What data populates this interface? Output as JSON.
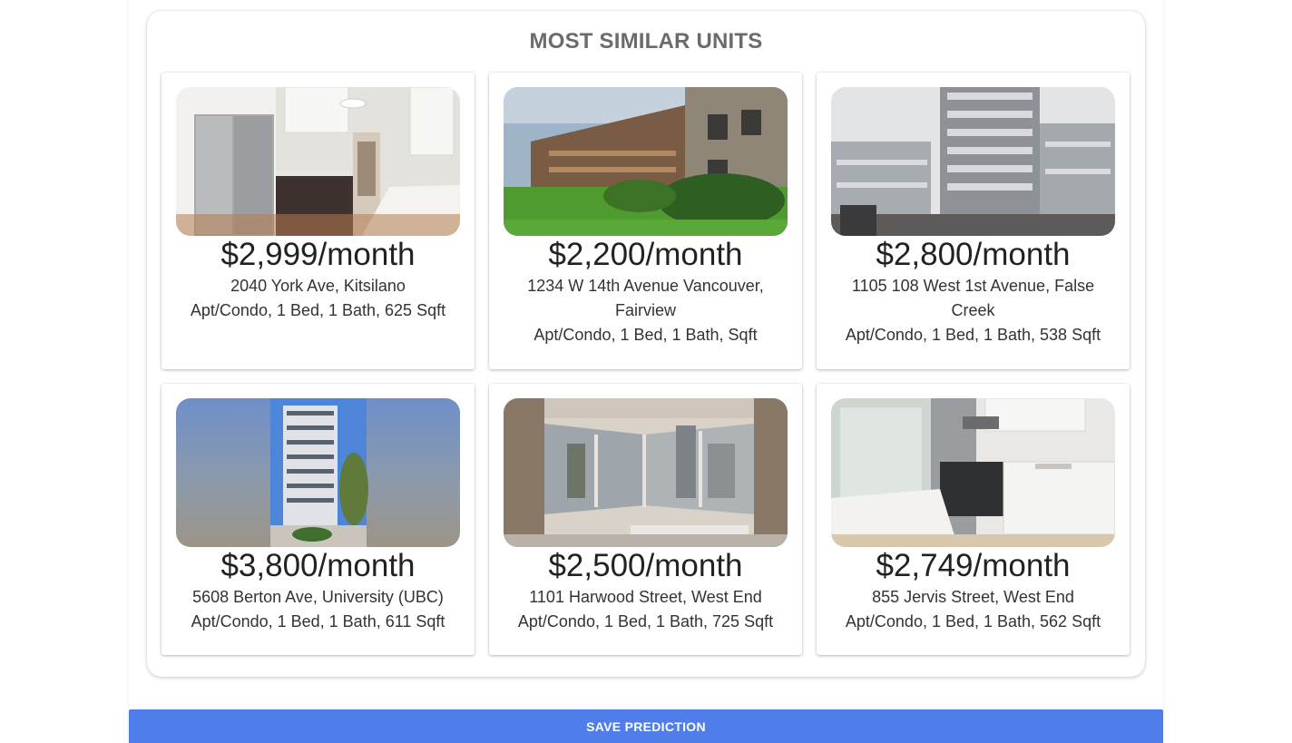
{
  "section": {
    "title": "MOST SIMILAR UNITS"
  },
  "listings": [
    {
      "price": "$2,999/month",
      "address": "2040 York Ave, Kitsilano",
      "specs": "Apt/Condo, 1 Bed, 1 Bath, 625 Sqft",
      "photo": "kitchen-photo"
    },
    {
      "price": "$2,200/month",
      "address": "1234 W 14th Avenue Vancouver, Fairview",
      "specs": "Apt/Condo, 1 Bed, 1 Bath, Sqft",
      "photo": "brick-building-photo"
    },
    {
      "price": "$2,800/month",
      "address": "1105 108 West 1st Avenue, False Creek",
      "specs": "Apt/Condo, 1 Bed, 1 Bath, 538 Sqft",
      "photo": "highrise-photo"
    },
    {
      "price": "$3,800/month",
      "address": "5608 Berton Ave, University (UBC)",
      "specs": "Apt/Condo, 1 Bed, 1 Bath, 611 Sqft",
      "photo": "tower-photo"
    },
    {
      "price": "$2,500/month",
      "address": "1101 Harwood Street, West End",
      "specs": "Apt/Condo, 1 Bed, 1 Bath, 725 Sqft",
      "photo": "window-corner-photo"
    },
    {
      "price": "$2,749/month",
      "address": "855 Jervis Street, West End",
      "specs": "Apt/Condo, 1 Bed, 1 Bath, 562 Sqft",
      "photo": "kitchen-island-photo"
    }
  ],
  "actions": {
    "save_label": "SAVE PREDICTION"
  },
  "colors": {
    "accent": "#4f7de9",
    "title": "#6b6b6b",
    "text": "#222222"
  }
}
